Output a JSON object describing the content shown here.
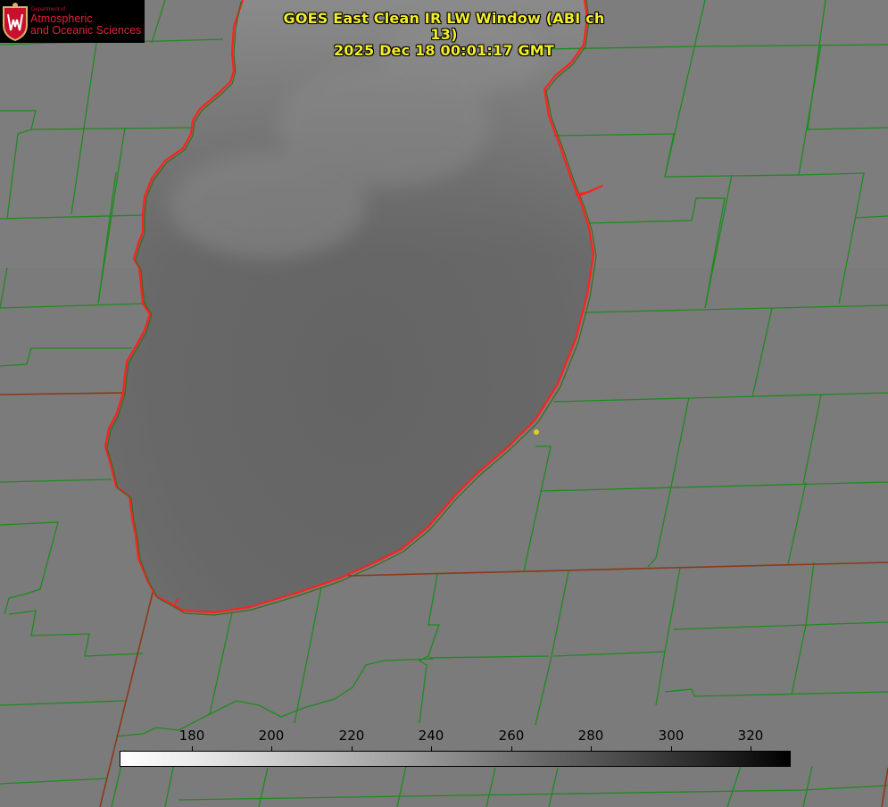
{
  "title": {
    "line1": "GOES East Clean IR LW Window (ABI ch 13)",
    "line2": "2025 Dec 18 00:01:17 GMT"
  },
  "logo": {
    "dept": "Department of",
    "line1": "Atmospheric",
    "line2": "and Oceanic Sciences",
    "icon": "uw-crest-icon"
  },
  "colorbar": {
    "ticks": [
      "180",
      "200",
      "220",
      "240",
      "260",
      "280",
      "300",
      "320"
    ]
  },
  "colors": {
    "county_lines": "#1f8a1f",
    "coastline": "#ff2020",
    "title": "#f4ee2a",
    "marker": "#e0d020"
  }
}
